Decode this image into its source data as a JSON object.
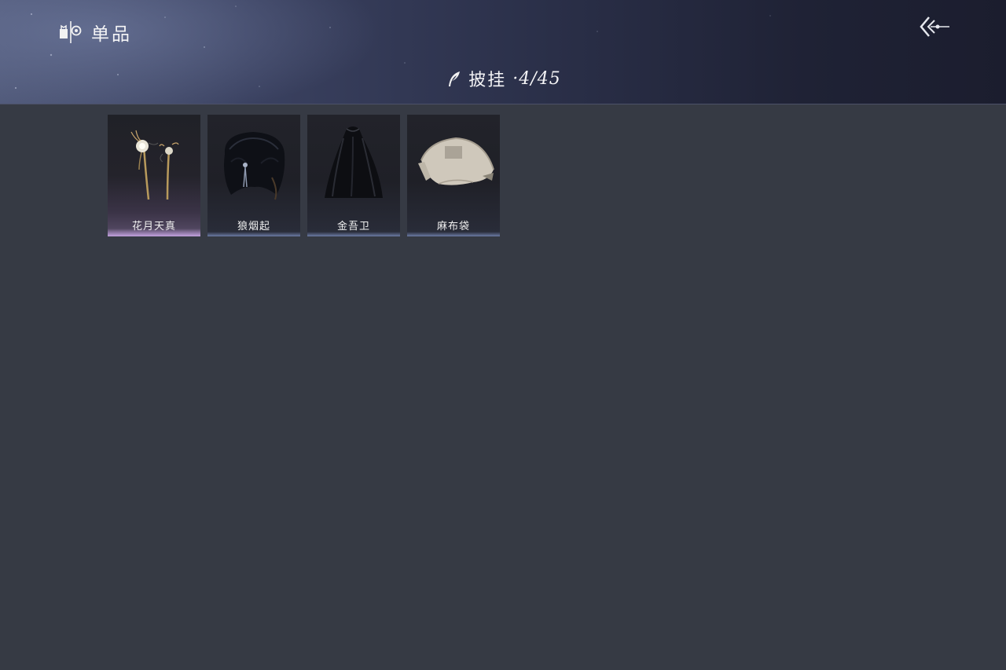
{
  "header": {
    "title": "单品",
    "title_icon": "wardrobe-icon",
    "back_icon": "back-arrow-icon"
  },
  "category": {
    "icon": "feather-icon",
    "name": "披挂",
    "count": "·4/45"
  },
  "items": [
    {
      "name": "花月天真",
      "icon": "hairpin-icon",
      "rarity_color": "#c9a6e6"
    },
    {
      "name": "狼烟起",
      "icon": "fur-collar-icon",
      "rarity_color": "#8ea0cc"
    },
    {
      "name": "金吾卫",
      "icon": "cloak-icon",
      "rarity_color": "#8ea0cc"
    },
    {
      "name": "麻布袋",
      "icon": "sack-icon",
      "rarity_color": "#8ea0cc"
    }
  ]
}
